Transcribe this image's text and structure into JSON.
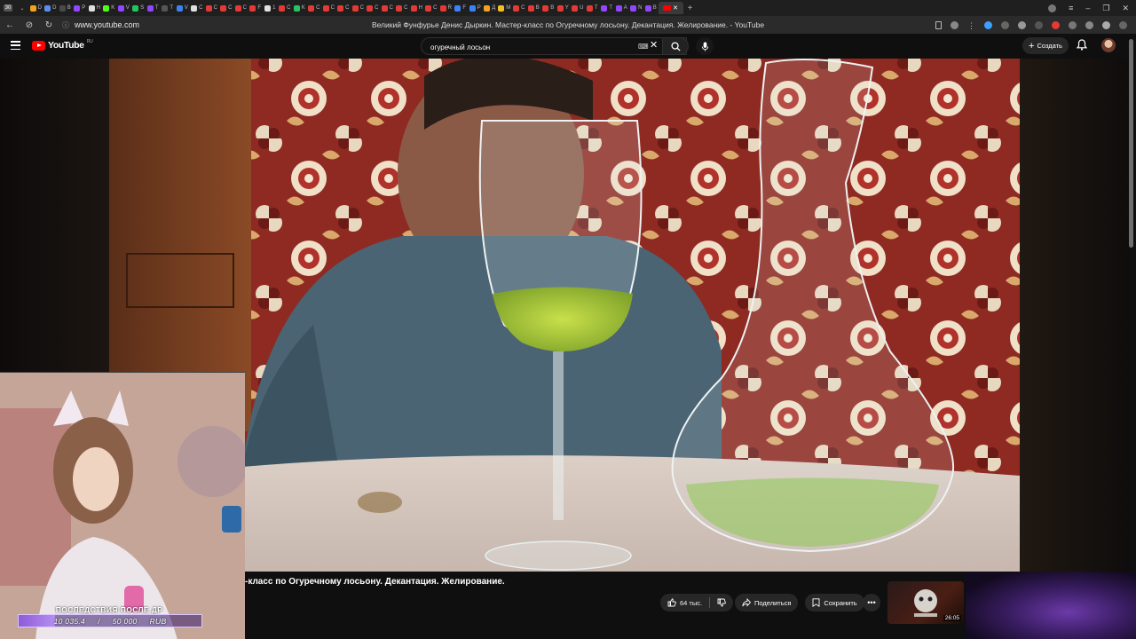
{
  "browser": {
    "tabs": [
      {
        "label": "D",
        "color": "#f4a020"
      },
      {
        "label": "D",
        "color": "#5b8def"
      },
      {
        "label": "B",
        "color": "#4a4a4a"
      },
      {
        "label": "P",
        "color": "#9146ff"
      },
      {
        "label": "H",
        "color": "#e0e0e0"
      },
      {
        "label": "K",
        "color": "#53fc18"
      },
      {
        "label": "V",
        "color": "#9146ff"
      },
      {
        "label": "S",
        "color": "#22c55e"
      },
      {
        "label": "T",
        "color": "#9146ff"
      },
      {
        "label": "T",
        "color": "#555555"
      },
      {
        "label": "V",
        "color": "#3b82f6"
      },
      {
        "label": "C",
        "color": "#e0e0e0"
      },
      {
        "label": "C",
        "color": "#e53935"
      },
      {
        "label": "C",
        "color": "#e53935"
      },
      {
        "label": "C",
        "color": "#e53935"
      },
      {
        "label": "F",
        "color": "#e53935"
      },
      {
        "label": "1",
        "color": "#e0e0e0"
      },
      {
        "label": "C",
        "color": "#e53935"
      },
      {
        "label": "K",
        "color": "#22c55e"
      },
      {
        "label": "C",
        "color": "#e53935"
      },
      {
        "label": "C",
        "color": "#e53935"
      },
      {
        "label": "C",
        "color": "#e53935"
      },
      {
        "label": "C",
        "color": "#e53935"
      },
      {
        "label": "C",
        "color": "#e53935"
      },
      {
        "label": "C",
        "color": "#e53935"
      },
      {
        "label": "C",
        "color": "#e53935"
      },
      {
        "label": "H",
        "color": "#e53935"
      },
      {
        "label": "C",
        "color": "#e53935"
      },
      {
        "label": "R",
        "color": "#e53935"
      },
      {
        "label": "F",
        "color": "#3b82f6"
      },
      {
        "label": "P",
        "color": "#3b82f6"
      },
      {
        "label": "Д",
        "color": "#f4a020"
      },
      {
        "label": "M",
        "color": "#f4c020"
      },
      {
        "label": "C",
        "color": "#e53935"
      },
      {
        "label": "B",
        "color": "#e53935"
      },
      {
        "label": "B",
        "color": "#e53935"
      },
      {
        "label": "Y",
        "color": "#e53935"
      },
      {
        "label": "U",
        "color": "#e53935"
      },
      {
        "label": "T",
        "color": "#e53935"
      },
      {
        "label": "T",
        "color": "#9146ff"
      },
      {
        "label": "A",
        "color": "#9146ff"
      },
      {
        "label": "N",
        "color": "#9146ff"
      },
      {
        "label": "B",
        "color": "#9146ff"
      }
    ],
    "active_tab_icon": "youtube-icon",
    "address": "www.youtube.com",
    "page_title": "Великий Фунфурье Денис Дыркин. Мастер-класс по Огуречному лосьону. Декантация. Желирование. - YouTube"
  },
  "youtube": {
    "logo_text": "YouTube",
    "logo_region": "RU",
    "search_value": "огуречный лосьон",
    "create_label": "Создать"
  },
  "video": {
    "title": "-класс по Огуречному лосьону. Декантация. Желирование.",
    "likes": "64 тыс.",
    "share_label": "Поделиться",
    "save_label": "Сохранить",
    "next_duration": "26:05"
  },
  "overlay": {
    "donation_title": "ПОСЛЕДСТВИЯ ПОСЛЕ ДР",
    "donation_current": "10",
    "donation_current_rest": "035.4",
    "donation_sep": "/",
    "donation_goal": "50",
    "donation_goal_rest": "000",
    "donation_currency": "RUB",
    "donation_progress": 0.2
  },
  "colors": {
    "yt_red": "#ff0000",
    "bg": "#0f0f0f",
    "pill": "#272727",
    "donation_purple": "#8f5bd8"
  }
}
